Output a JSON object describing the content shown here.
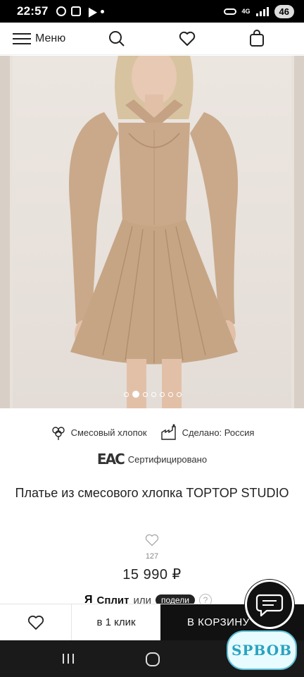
{
  "status_bar": {
    "time": "22:57",
    "network": "4G",
    "battery": "46"
  },
  "header": {
    "menu_label": "Меню",
    "icons": [
      "menu-icon",
      "search-icon",
      "heart-icon",
      "bag-icon"
    ]
  },
  "gallery": {
    "image_count": 7,
    "active_index": 1
  },
  "features": [
    {
      "icon": "cotton-icon",
      "label": "Смесовый хлопок"
    },
    {
      "icon": "factory-icon",
      "label": "Сделано: Россия"
    },
    {
      "icon": "eac-icon",
      "label": "Сертифицировано",
      "mark": "EAC"
    }
  ],
  "product": {
    "title": "Платье из смесового хлопка TOPTOP STUDIO",
    "favorites_count": "127",
    "price": "15 990 ₽"
  },
  "split": {
    "ya": "Я",
    "brand": "Сплит",
    "or": "или",
    "badge": "подели",
    "help": "?"
  },
  "actions": {
    "one_click": "в 1 клик",
    "add_to_cart": "В КОРЗИНУ"
  },
  "watermark": "SPBOB",
  "colors": {
    "accent": "#111111",
    "photo_bg": "#e9e2dc",
    "dress": "#c9a98a"
  }
}
